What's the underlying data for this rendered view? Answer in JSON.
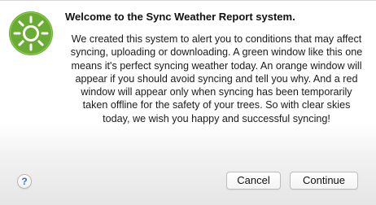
{
  "dialog": {
    "icon": "sun-icon",
    "icon_color": "#6aab33",
    "title": "Welcome to the Sync Weather Report system.",
    "message_lines": [
      "We created this system to alert you to conditions that may affect",
      "syncing, uploading or downloading. A green window like this one",
      "means it's perfect syncing weather today. An orange window will",
      "appear if you should avoid syncing and tell you why. And a red",
      "window will appear only when syncing has been temporarily",
      "taken offline for the safety of your trees. So with clear skies",
      "today, we wish you happy and successful syncing!"
    ]
  },
  "buttons": {
    "help_label": "?",
    "cancel_label": "Cancel",
    "continue_label": "Continue"
  }
}
